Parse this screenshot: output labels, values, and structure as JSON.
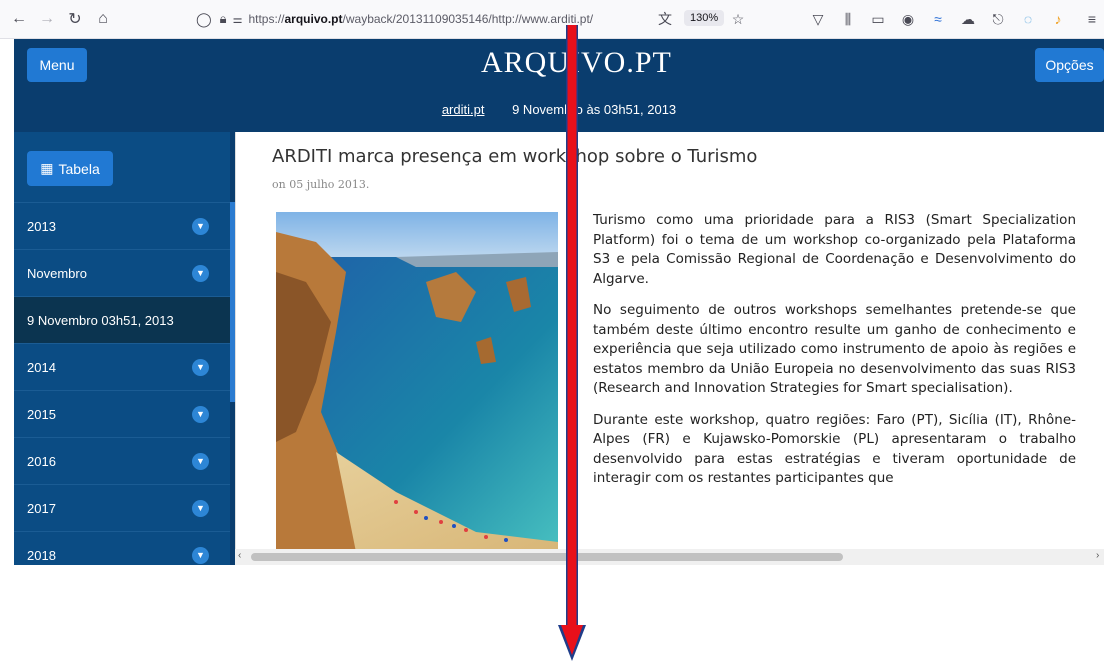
{
  "browser": {
    "url_prefix": "https://",
    "url_domain": "arquivo.pt",
    "url_path": "/wayback/20131109035146/http://www.arditi.pt/",
    "zoom": "130%",
    "icons": [
      "back-icon",
      "forward-icon",
      "reload-icon",
      "home-icon",
      "shield-icon",
      "lock-icon",
      "permissions-icon",
      "translate-icon",
      "bookmark-star-icon",
      "pocket-icon",
      "library-icon",
      "sidebar-icon",
      "account-icon",
      "extension-icon",
      "cloud-icon",
      "share-icon",
      "edge-icon",
      "bird-icon",
      "menu-icon"
    ]
  },
  "header": {
    "menu_label": "Menu",
    "logo": "ARQUIVO.PT",
    "options_label": "Opções",
    "site_link": "arditi.pt",
    "date_text": "9 Novembro às 03h51, 2013"
  },
  "sidebar": {
    "tabela_label": "Tabela",
    "items": [
      {
        "label": "2013"
      },
      {
        "label": "Novembro"
      },
      {
        "label": "9 Novembro 03h51, 2013"
      },
      {
        "label": "2014"
      },
      {
        "label": "2015"
      },
      {
        "label": "2016"
      },
      {
        "label": "2017"
      },
      {
        "label": "2018"
      }
    ]
  },
  "article": {
    "title": "ARDITI marca presença em workshop sobre o Turismo",
    "date": "on 05 julho 2013.",
    "paragraphs": [
      "Turismo como uma prioridade para a RIS3 (Smart Specialization Platform) foi o tema de um workshop co-organizado pela Plataforma S3 e pela Comissão Regional de Coordenação e Desenvolvimento do Algarve.",
      "No seguimento de outros workshops semelhantes pretende-se que também deste último encontro resulte um ganho de conhecimento e experiência que seja utilizado como instrumento de apoio às regiões e estatos membro da União Europeia no desenvolvimento das suas  RIS3 (Research and Innovation Strategies for Smart specialisation).",
      "Durante este workshop, quatro regiões: Faro (PT), Sicília (IT), Rhône-Alpes (FR) e Kujawsko-Pomorskie (PL) apresentaram o trabalho desenvolvido para estas estratégias e tiveram oportunidade de interagir com os restantes participantes que"
    ]
  },
  "colors": {
    "header_bg": "#0a3d6e",
    "sidebar_bg": "#0b4c84",
    "button_blue": "#2179d3",
    "arrow_red": "#e8101a",
    "arrow_blue": "#1f3d8a"
  }
}
